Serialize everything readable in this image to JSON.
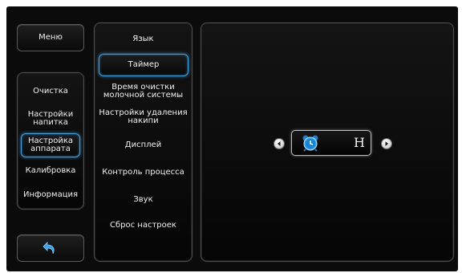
{
  "left_menu": {
    "menu_label": "Меню",
    "items": [
      {
        "label": "Очистка"
      },
      {
        "label": "Настройки\nнапитка"
      },
      {
        "label": "Настройка\nаппарата",
        "selected": true
      },
      {
        "label": "Калибровка"
      },
      {
        "label": "Информация"
      }
    ],
    "back_icon": "back-arrow-icon"
  },
  "sub_menu": {
    "items": [
      {
        "label": "Язык"
      },
      {
        "label": "Таймер",
        "selected": true
      },
      {
        "label": "Время очистки\nмолочной системы"
      },
      {
        "label": "Настройки удаления\nнакипи"
      },
      {
        "label": "Дисплей"
      },
      {
        "label": "Контроль процесса"
      },
      {
        "label": "Звук"
      },
      {
        "label": "Сброс настроек"
      }
    ]
  },
  "timer": {
    "icon": "alarm-clock-icon",
    "value": "H",
    "prev_icon": "chevron-left-icon",
    "next_icon": "chevron-right-icon"
  },
  "colors": {
    "accent": "#4aa0d8",
    "back_arrow": "#3aa0e8"
  }
}
